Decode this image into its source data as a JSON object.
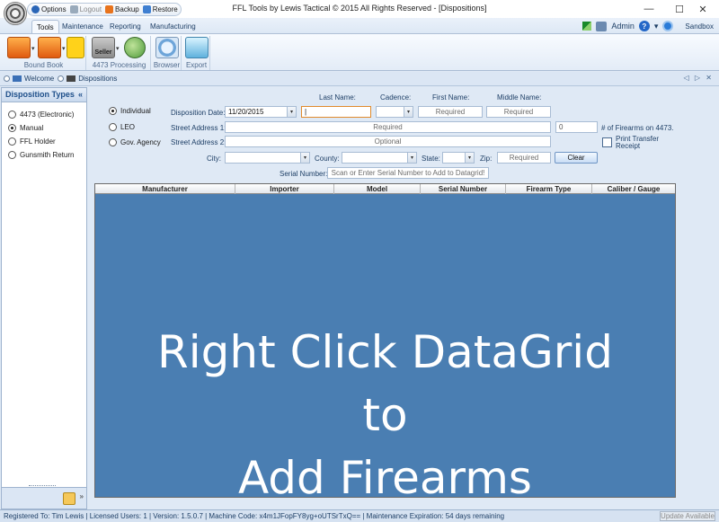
{
  "window": {
    "title": "FFL Tools by Lewis Tactical © 2015 All Rights Reserved - [Dispositions]",
    "minimize": "—",
    "maximize": "☐",
    "close": "✕"
  },
  "quick_access": {
    "options": "Options",
    "logout": "Logout",
    "backup": "Backup",
    "restore": "Restore"
  },
  "ribbon_tabs": [
    "Tools",
    "Maintenance",
    "Reporting",
    "Manufacturing"
  ],
  "user": {
    "name": "Admin",
    "help": "?",
    "environment": "Sandbox",
    "dropdown": "▾"
  },
  "ribbon_groups": {
    "bound_book": "Bound Book",
    "processing": "4473 Processing",
    "browser": "Browser",
    "export": "Export",
    "seller_label": "Seller",
    "dropdown": "▾"
  },
  "doc_tabs": [
    "Welcome",
    "Dispositions"
  ],
  "doc_strip_controls": "◁ ▷ ✕",
  "sidebar": {
    "title": "Disposition Types",
    "collapse": "«",
    "expand": "»",
    "items": [
      {
        "label": "4473 (Electronic)",
        "selected": false
      },
      {
        "label": "Manual",
        "selected": true
      },
      {
        "label": "FFL Holder",
        "selected": false
      },
      {
        "label": "Gunsmith Return",
        "selected": false
      }
    ]
  },
  "form": {
    "recipient_types": [
      {
        "label": "Individual",
        "selected": true
      },
      {
        "label": "LEO",
        "selected": false
      },
      {
        "label": "Gov. Agency",
        "selected": false
      }
    ],
    "headers": {
      "last_name": "Last Name:",
      "cadence": "Cadence:",
      "first_name": "First Name:",
      "middle_name": "Middle Name:"
    },
    "disposition_date_label": "Disposition Date:",
    "disposition_date": "11/20/2015",
    "last_name_value": "|",
    "first_name_placeholder": "Required",
    "middle_name_placeholder": "Required",
    "street1_label": "Street Address 1:",
    "street1_placeholder": "Required",
    "firearm_count": "0",
    "firearm_count_label": "# of Firearms on 4473.",
    "street2_label": "Street Address 2:",
    "street2_placeholder": "Optional",
    "print_transfer_label": "Print Transfer Receipt",
    "city_label": "City:",
    "county_label": "County:",
    "state_label": "State:",
    "zip_label": "Zip:",
    "zip_placeholder": "Required",
    "clear_button": "Clear",
    "serial_label": "Serial Number:",
    "serial_placeholder": "Scan or Enter Serial Number to Add to Datagrid!",
    "dropdown": "▾"
  },
  "grid": {
    "columns": [
      "Manufacturer",
      "Importer",
      "Model",
      "Serial Number",
      "Firearm Type",
      "Caliber / Gauge"
    ],
    "overlay_lines": [
      "Right Click DataGrid",
      "to",
      "Add Firearms"
    ]
  },
  "status": {
    "text": "Registered To: Tim Lewis | Licensed Users: 1 | Version: 1.5.0.7 | Machine Code: x4m1JFopFY8yg+oUTSrTxQ== |  Maintenance Expiration: 54 days remaining",
    "update_button": "Update Available"
  }
}
